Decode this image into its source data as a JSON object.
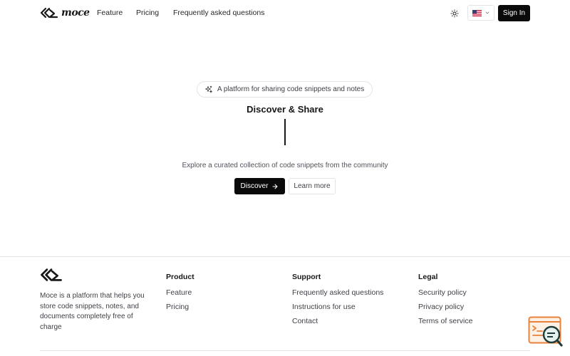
{
  "header": {
    "logo_text": "moce",
    "nav": [
      "Feature",
      "Pricing",
      "Frequently asked questions"
    ],
    "theme_icon": "sun-icon",
    "language_icon": "us-flag-icon",
    "sign_in_label": "Sign In"
  },
  "hero": {
    "badge_text": "A platform for sharing code snippets and notes",
    "title": "Discover & Share",
    "subtitle": "Explore a curated collection of code snippets from the community",
    "discover_label": "Discover",
    "learn_more_label": "Learn more"
  },
  "footer": {
    "description": "Moce is a platform that helps you store code snippets, notes, and documents completely free of charge",
    "columns": [
      {
        "title": "Product",
        "links": [
          "Feature",
          "Pricing"
        ]
      },
      {
        "title": "Support",
        "links": [
          "Frequently asked questions",
          "Instructions for use",
          "Contact"
        ]
      },
      {
        "title": "Legal",
        "links": [
          "Security policy",
          "Privacy policy",
          "Terms of service"
        ]
      }
    ]
  },
  "colors": {
    "primary": "#0a0a0a",
    "border": "#e4e4e7",
    "widget_accent": "#e8823a"
  }
}
